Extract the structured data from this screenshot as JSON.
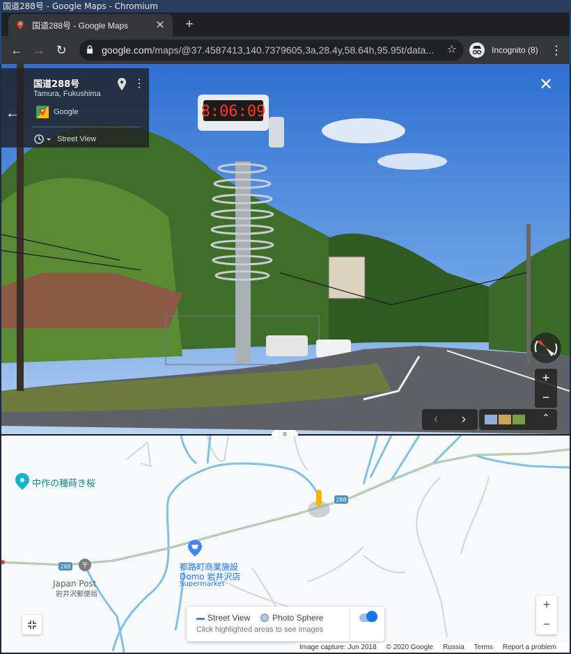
{
  "window": {
    "title": "国道288号 - Google Maps - Chromium"
  },
  "tab": {
    "title": "国道288号 - Google Maps",
    "close": "✕",
    "new_tab": "+"
  },
  "toolbar": {
    "back": "←",
    "forward": "→",
    "reload": "↻",
    "url_host": "google.com",
    "url_path": "/maps/@37.4587413,140.7379605,3a,28.4y,58.64h,95.95t/data...",
    "star": "☆",
    "incognito_label": "Incognito (8)",
    "menu": "⋮"
  },
  "streetview": {
    "place_title": "国道288号",
    "place_sub": "Tamura, Fukushima",
    "provider": "Google",
    "mode_label": "Street View",
    "clock_text": "8:06:09",
    "back": "←",
    "close": "✕",
    "zoom_in": "+",
    "zoom_out": "−",
    "prev": "‹",
    "next": "›",
    "expand": "⌃"
  },
  "map": {
    "grip": "≡",
    "pois": {
      "cherry_tree": "中作の種蒔き桜",
      "post_en": "Japan Post",
      "post_ja": "岩井沢郵便局",
      "domo_line1": "都路町商業施設",
      "domo_line2": "Domo 岩井沢店",
      "domo_type": "Supermarket"
    },
    "route_label": "288",
    "zoom_in": "+",
    "zoom_out": "−",
    "legend": {
      "street_view": "Street View",
      "photo_sphere": "Photo Sphere",
      "hint": "Click highlighted areas to see images"
    },
    "footer": {
      "capture": "Image capture: Jun 2018",
      "copyright": "© 2020 Google",
      "region": "Russia",
      "terms": "Terms",
      "report": "Report a problem"
    }
  },
  "colors": {
    "chrome_bg": "#202124",
    "toolbar_bg": "#35363a",
    "route_blue": "#7fc1e6",
    "accent": "#1a73e8"
  }
}
